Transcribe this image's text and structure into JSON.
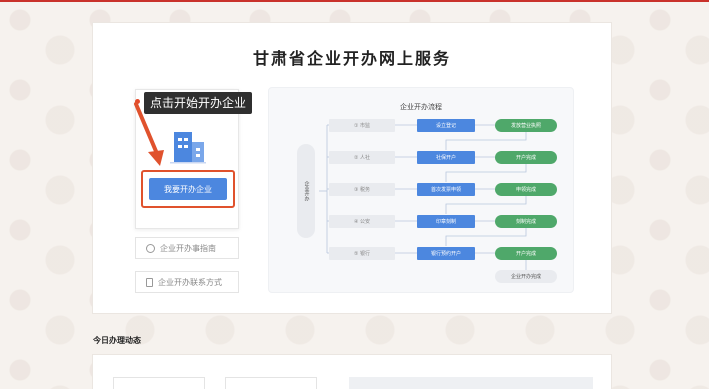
{
  "page": {
    "title": "甘肃省企业开办网上服务"
  },
  "start": {
    "tooltip": "点击开始开办企业",
    "button_label": "我要开办企业"
  },
  "side_links": [
    {
      "label": "企业开办事指南",
      "icon": "compass-icon"
    },
    {
      "label": "企业开办联系方式",
      "icon": "phone-icon"
    }
  ],
  "flow": {
    "title": "企业开办流程",
    "side_label": "企业开办",
    "rows": [
      {
        "dept": "① 市监",
        "step": "设立登记",
        "done": "发放营业执照"
      },
      {
        "dept": "② 人社",
        "step": "社保开户",
        "done": "开户完成"
      },
      {
        "dept": "③ 税务",
        "step": "首次发票申领",
        "done": "申领完成"
      },
      {
        "dept": "④ 公安",
        "step": "印章刻制",
        "done": "刻制完成"
      },
      {
        "dept": "⑤ 银行",
        "step": "银行预约开户",
        "done": "开户完成"
      }
    ],
    "final": "企业开办完成"
  },
  "sections": {
    "today_title": "今日办理动态"
  },
  "colors": {
    "accent": "#4c87df",
    "success": "#4fa86a",
    "highlight": "#e0522d",
    "brand_red": "#c9322b"
  }
}
